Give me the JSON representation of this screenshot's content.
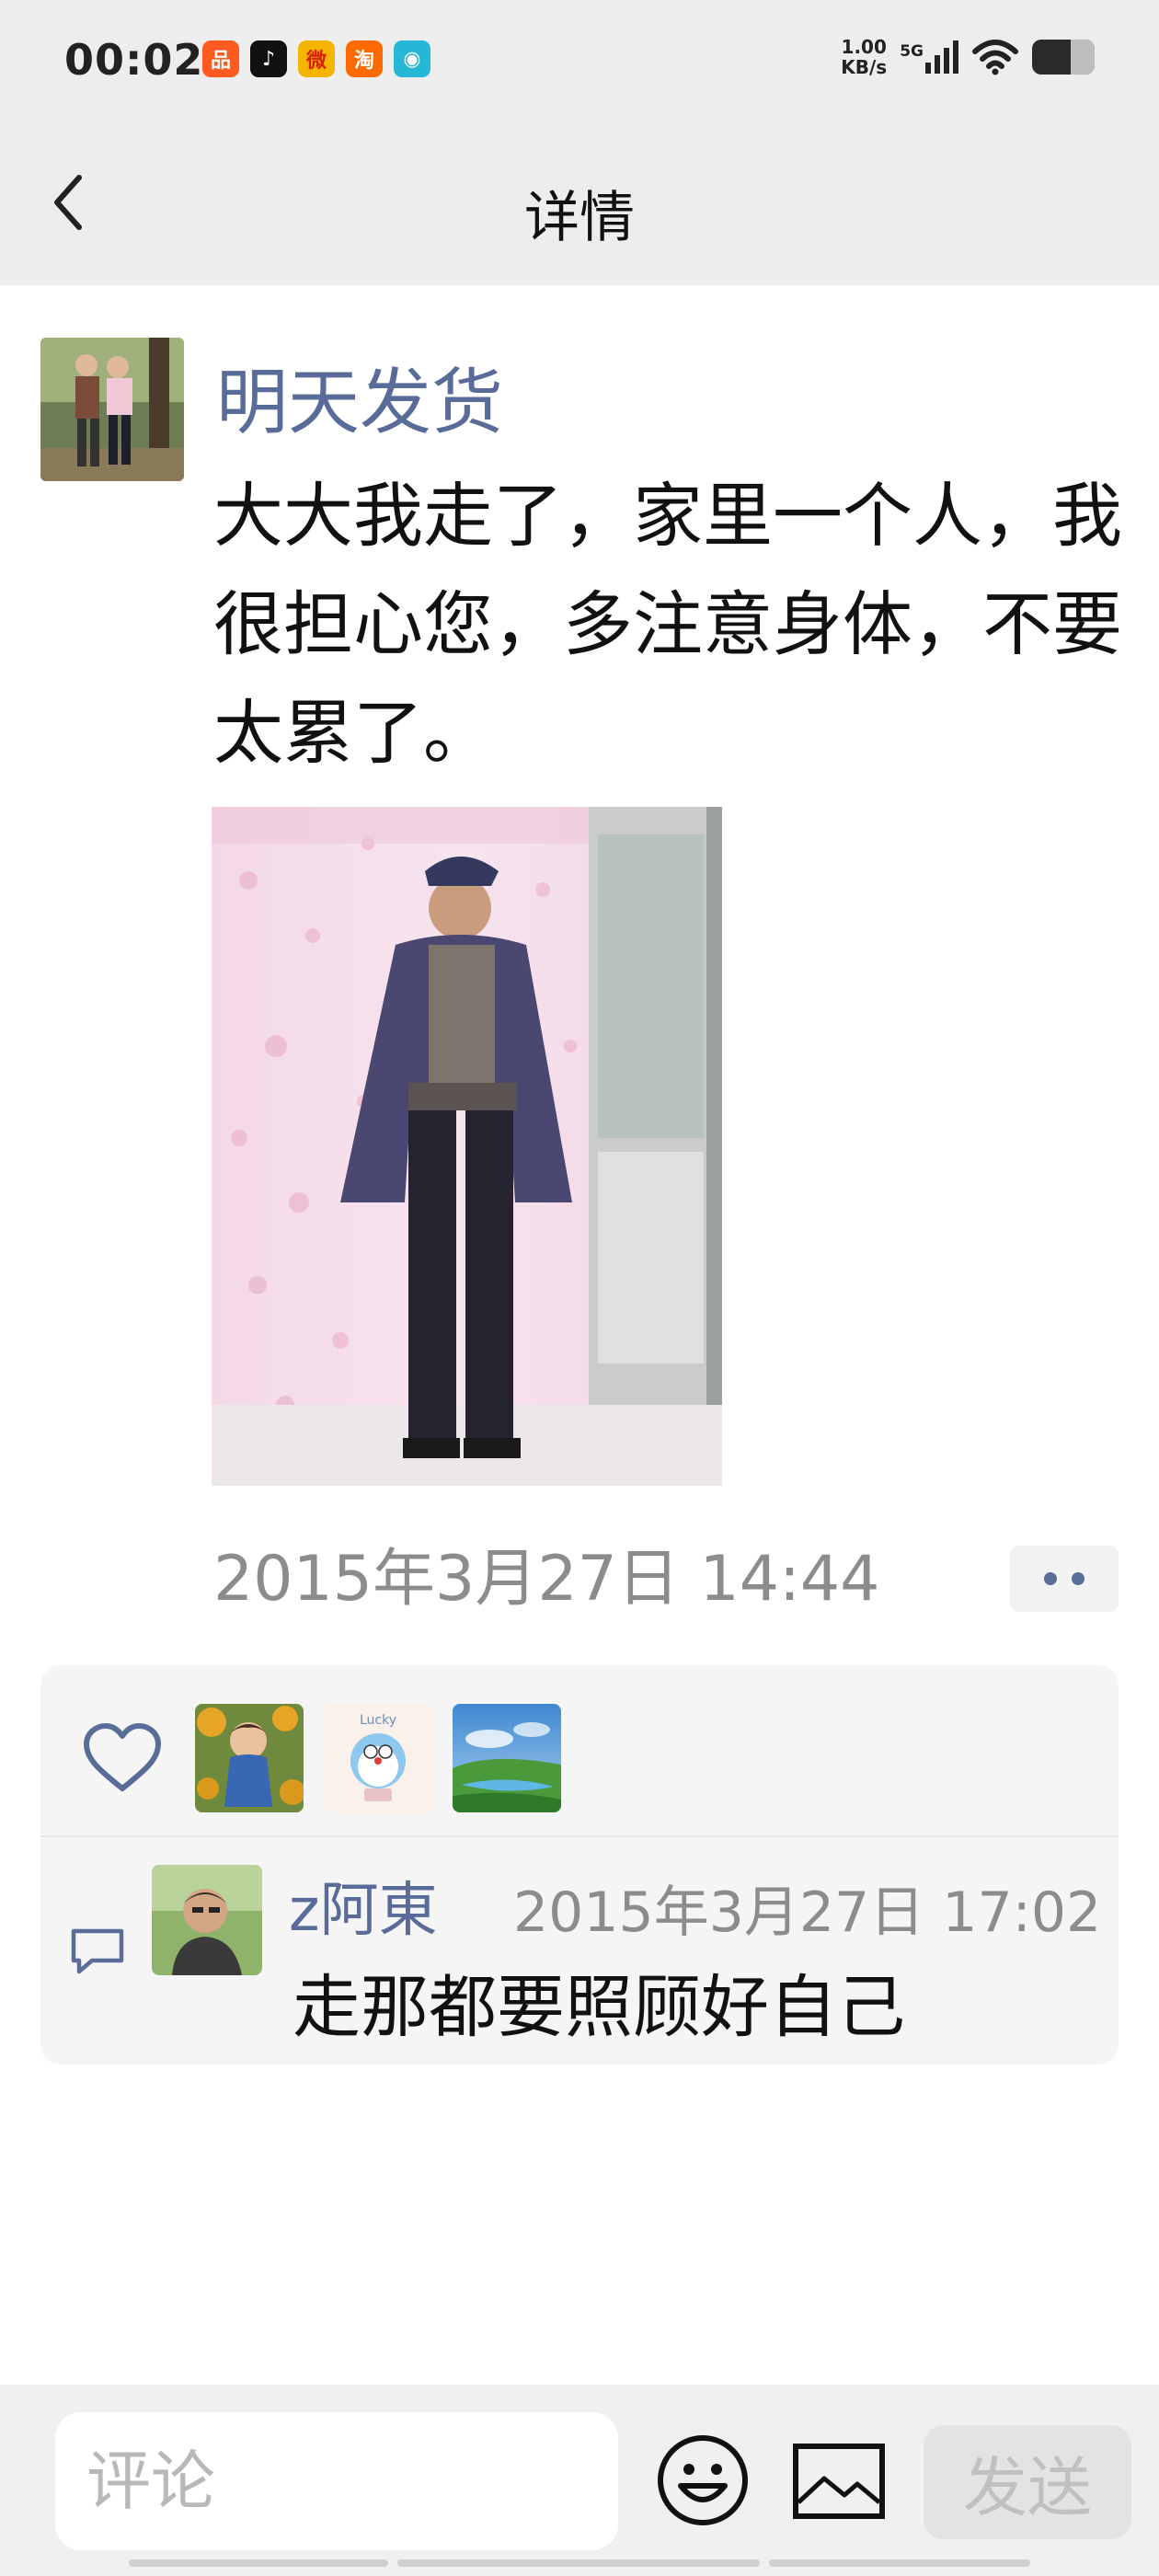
{
  "status_bar": {
    "time": "00:02",
    "apps": [
      {
        "icon": "xiaohongshu-icon",
        "glyph": "品",
        "color": "#ff5a1f"
      },
      {
        "icon": "douyin-icon",
        "glyph": "♪",
        "color": "#111111"
      },
      {
        "icon": "weibo-icon",
        "glyph": "微",
        "color": "#f5b400"
      },
      {
        "icon": "taobao-icon",
        "glyph": "淘",
        "color": "#ff6a00"
      },
      {
        "icon": "camera-app-icon",
        "glyph": "◉",
        "color": "#27b7d6"
      }
    ],
    "net_speed_value": "1.00",
    "net_speed_unit": "KB/s",
    "signal_label": "5G",
    "battery_level": 0.62
  },
  "header": {
    "title": "详情"
  },
  "post": {
    "author": "明天发货",
    "text": "大大我走了，家里一个人，我很担心您，多注意身体，不要太累了。",
    "timestamp": "2015年3月27日 14:44"
  },
  "comments": [
    {
      "author": "z阿東",
      "time": "2015年3月27日 17:02",
      "text": "走那都要照顾好自己"
    }
  ],
  "composer": {
    "placeholder": "评论",
    "send_label": "发送"
  },
  "colors": {
    "link_blue": "#596b98",
    "meta_gray": "#8c8c8c",
    "header_bg": "#ededed"
  }
}
